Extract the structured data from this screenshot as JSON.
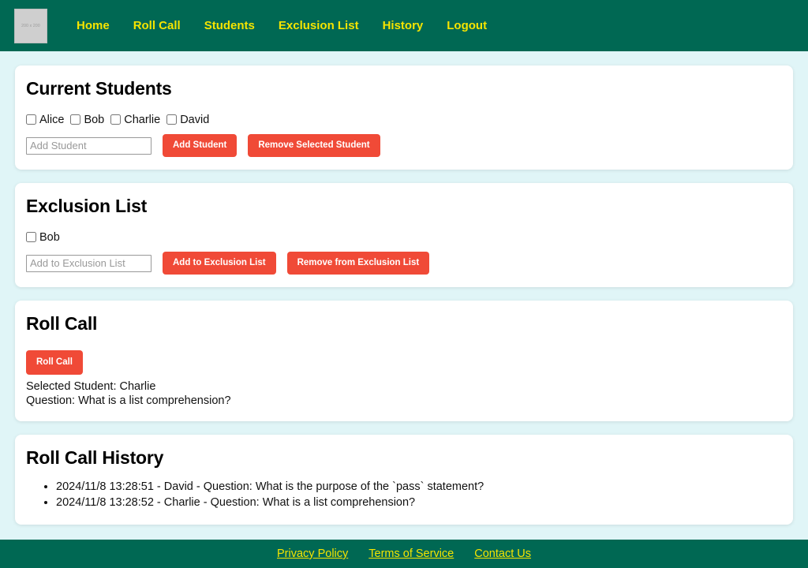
{
  "nav": {
    "logo_placeholder": "200 x 200",
    "logo_icon": "image-placeholder-icon",
    "links": [
      {
        "label": "Home"
      },
      {
        "label": "Roll Call"
      },
      {
        "label": "Students"
      },
      {
        "label": "Exclusion List"
      },
      {
        "label": "History"
      },
      {
        "label": "Logout"
      }
    ]
  },
  "students_section": {
    "title": "Current Students",
    "students": [
      {
        "name": "Alice",
        "checked": false
      },
      {
        "name": "Bob",
        "checked": false
      },
      {
        "name": "Charlie",
        "checked": false
      },
      {
        "name": "David",
        "checked": false
      }
    ],
    "input_placeholder": "Add Student",
    "input_value": "",
    "add_button": "Add Student",
    "remove_button": "Remove Selected Student"
  },
  "exclusion_section": {
    "title": "Exclusion List",
    "excluded": [
      {
        "name": "Bob",
        "checked": false
      }
    ],
    "input_placeholder": "Add to Exclusion List",
    "input_value": "",
    "add_button": "Add to Exclusion List",
    "remove_button": "Remove from Exclusion List"
  },
  "rollcall_section": {
    "title": "Roll Call",
    "button": "Roll Call",
    "selected_student_line": "Selected Student: Charlie",
    "question_line": "Question: What is a list comprehension?"
  },
  "history_section": {
    "title": "Roll Call History",
    "entries": [
      {
        "text": "2024/11/8 13:28:51 - David - Question: What is the purpose of the `pass` statement?"
      },
      {
        "text": "2024/11/8 13:28:52 - Charlie - Question: What is a list comprehension?"
      }
    ]
  },
  "footer": {
    "links": [
      {
        "label": "Privacy Policy"
      },
      {
        "label": "Terms of Service"
      },
      {
        "label": "Contact Us"
      }
    ]
  },
  "colors": {
    "brand_green": "#006853",
    "accent_yellow": "#f5e400",
    "button_red": "#f04a37",
    "page_background": "#e0f5f7",
    "card_background": "#ffffff"
  }
}
